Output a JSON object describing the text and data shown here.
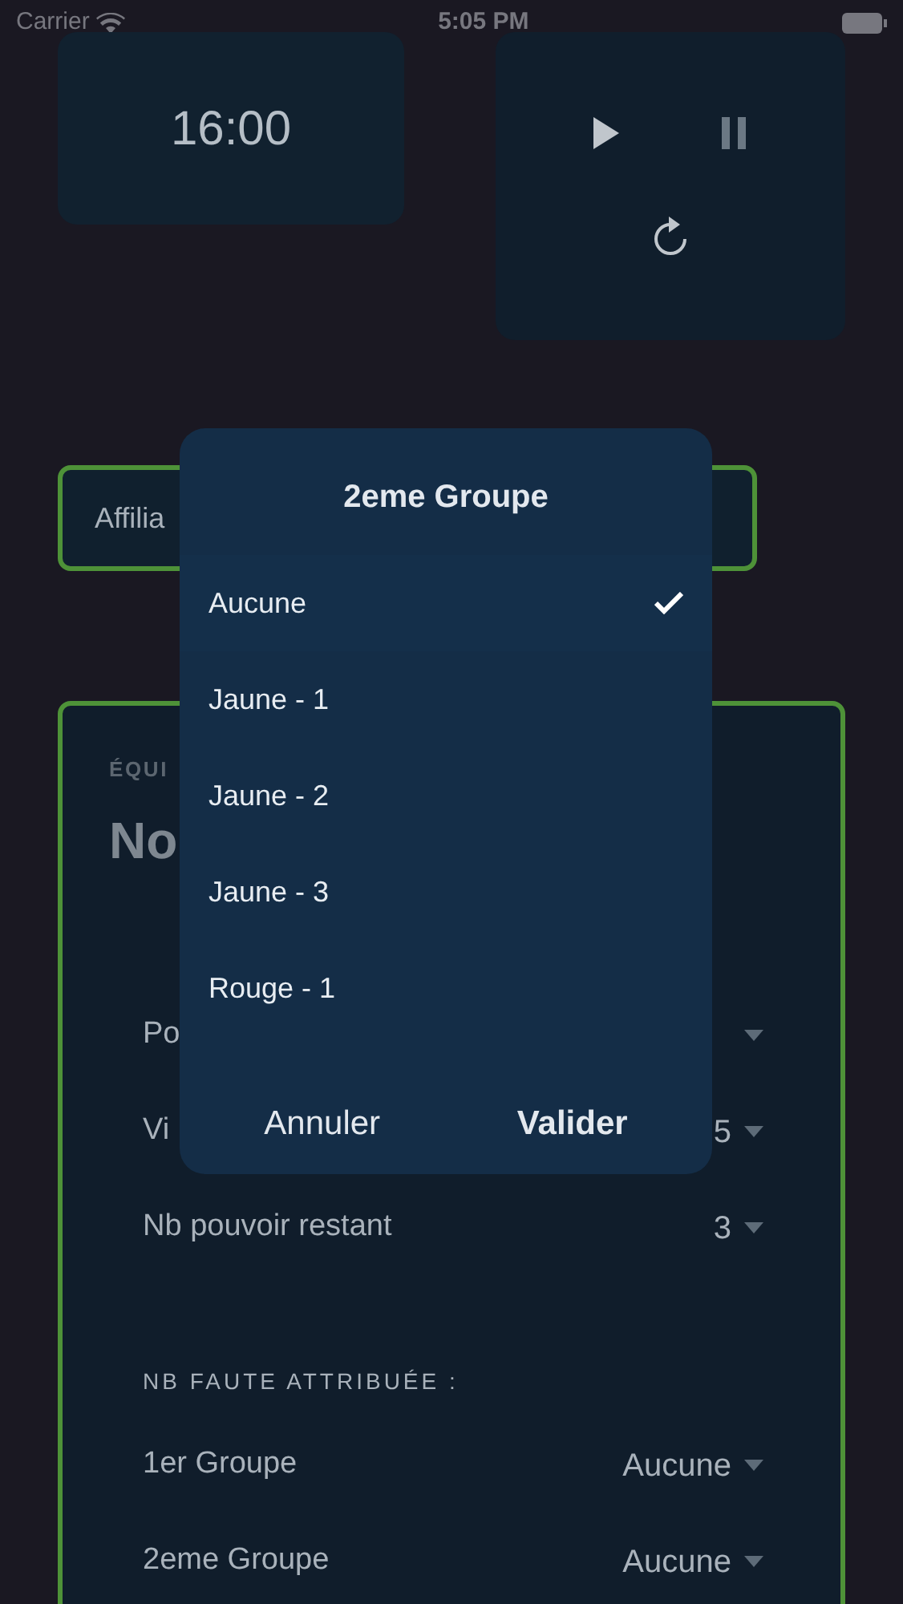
{
  "status_bar": {
    "carrier": "Carrier",
    "time": "5:05 PM"
  },
  "timer": {
    "time": "16:00"
  },
  "affiliation_field": {
    "value": "Affilia"
  },
  "team_card": {
    "label": "ÉQUI",
    "name": "No",
    "rows": [
      {
        "label": "Po"
      },
      {
        "label": "Vi",
        "value": "5"
      },
      {
        "label": "Nb pouvoir restant",
        "value": "3"
      }
    ],
    "section_title": "NB FAUTE ATTRIBUÉE :",
    "fault_rows": [
      {
        "label": "1er Groupe",
        "value": "Aucune"
      },
      {
        "label": "2eme Groupe",
        "value": "Aucune"
      }
    ]
  },
  "picker": {
    "title": "2eme Groupe",
    "options": [
      {
        "label": "Aucune",
        "selected": true
      },
      {
        "label": "Jaune - 1",
        "selected": false
      },
      {
        "label": "Jaune - 2",
        "selected": false
      },
      {
        "label": "Jaune - 3",
        "selected": false
      },
      {
        "label": "Rouge - 1",
        "selected": false
      }
    ],
    "cancel": "Annuler",
    "confirm": "Valider"
  }
}
